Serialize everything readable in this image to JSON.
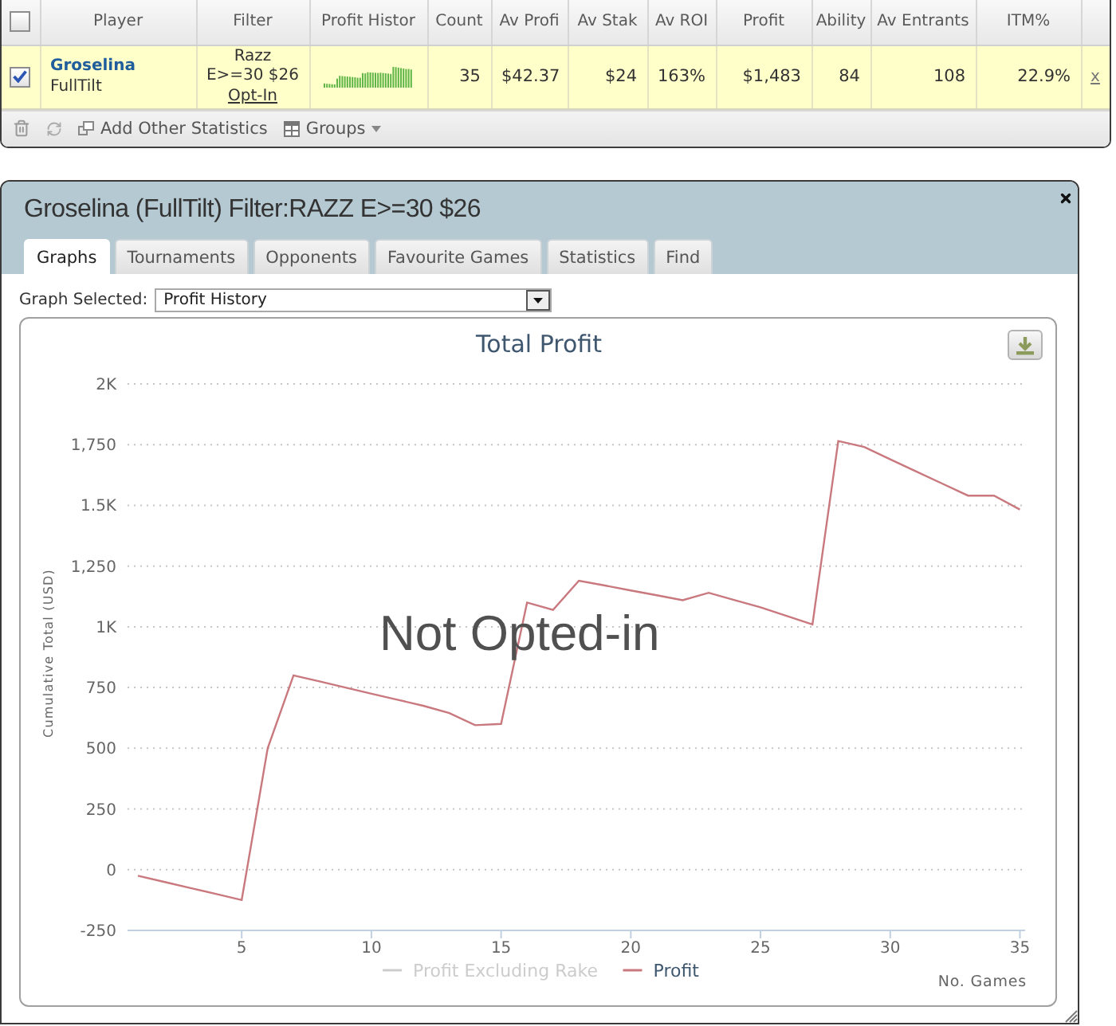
{
  "players_table": {
    "select_all": {
      "checked": false
    },
    "columns": [
      "Player",
      "Filter",
      "Profit Histor",
      "Count",
      "Av Profi",
      "Av Stak",
      "Av ROI",
      "Profit",
      "Ability",
      "Av Entrants",
      "ITM%"
    ],
    "rows": [
      {
        "checked": true,
        "player": "Groselina",
        "site": "FullTilt",
        "filter_lines": [
          "Razz",
          "E>=30 $26"
        ],
        "filter_link": "Opt-In",
        "stats": [
          "35",
          "$42.37",
          "$24",
          "163%",
          "$1,483",
          "84",
          "108",
          "22.9%"
        ],
        "remove_link": "x"
      }
    ]
  },
  "toolbar": {
    "add_statistics": "Add Other Statistics",
    "groups": "Groups"
  },
  "dialog": {
    "title": "Groselina (FullTilt) Filter:RAZZ E>=30 $26",
    "tabs": [
      {
        "label": "Graphs",
        "selected": true
      },
      {
        "label": "Tournaments",
        "selected": false
      },
      {
        "label": "Opponents",
        "selected": false
      },
      {
        "label": "Favourite Games",
        "selected": false
      },
      {
        "label": "Statistics",
        "selected": false
      },
      {
        "label": "Find",
        "selected": false
      }
    ],
    "graph_select": {
      "label": "Graph Selected:",
      "value": "Profit History"
    },
    "chart": {
      "overlay_text": "Not Opted-in",
      "legend": [
        {
          "label": "Profit Excluding Rake",
          "visible": false
        }
      ],
      "chart_data": {
        "type": "line",
        "title": "Total Profit",
        "xlabel": "No. Games",
        "ylabel": "Cumulative Total (USD)",
        "grid": true,
        "x": [
          1,
          2,
          3,
          4,
          5,
          6,
          7,
          8,
          9,
          10,
          11,
          12,
          13,
          14,
          15,
          16,
          17,
          18,
          19,
          20,
          21,
          22,
          23,
          24,
          25,
          26,
          27,
          28,
          29,
          30,
          31,
          32,
          33,
          34,
          35
        ],
        "series": [
          {
            "name": "Profit",
            "color": "#c9787e",
            "values": [
              -25,
              -50,
              -75,
              -100,
              -125,
              500,
              800,
              775,
              750,
              725,
              700,
              675,
              645,
              595,
              600,
              1100,
              1070,
              1190,
              1170,
              1150,
              1130,
              1110,
              1140,
              1110,
              1080,
              1045,
              1010,
              1765,
              1740,
              1690,
              1640,
              1590,
              1540,
              1540,
              1483
            ]
          }
        ],
        "xlim": [
          0.6,
          35.2
        ],
        "ylim": [
          -250,
          2000
        ],
        "xticks": [
          5,
          10,
          15,
          20,
          25,
          30,
          35
        ],
        "yticks": [
          -250,
          0,
          250,
          500,
          750,
          {
            "value": 1000,
            "label": "1K"
          },
          {
            "value": 1250,
            "label": "1,250"
          },
          {
            "value": 1500,
            "label": "1.5K"
          },
          {
            "value": 1750,
            "label": "1,750"
          },
          {
            "value": 2000,
            "label": "2K"
          }
        ]
      }
    }
  }
}
